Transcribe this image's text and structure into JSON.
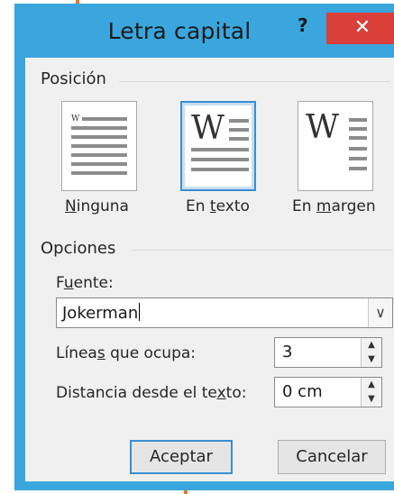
{
  "dialog": {
    "title": "Letra capital",
    "help_glyph": "?",
    "close_glyph": "✕"
  },
  "position": {
    "heading": "Posición",
    "options": [
      {
        "pre": "",
        "accel": "N",
        "post": "inguna",
        "selected": false
      },
      {
        "pre": "En ",
        "accel": "t",
        "post": "exto",
        "selected": true
      },
      {
        "pre": "En ",
        "accel": "m",
        "post": "argen",
        "selected": false
      }
    ],
    "glyph": "W"
  },
  "options": {
    "heading": "Opciones",
    "font_label": {
      "pre": "F",
      "accel": "u",
      "post": "ente:"
    },
    "font_value": "Jokerman",
    "lines_label": {
      "pre": "Línea",
      "accel": "s",
      "post": " que ocupa:"
    },
    "lines_value": "3",
    "distance_label": {
      "pre": "Distancia desde el te",
      "accel": "x",
      "post": "to:"
    },
    "distance_value": "0 cm"
  },
  "buttons": {
    "ok": "Aceptar",
    "cancel": "Cancelar"
  },
  "colors": {
    "frame": "#3aa6dd",
    "close": "#d9403a",
    "callout": "#e8782a"
  }
}
